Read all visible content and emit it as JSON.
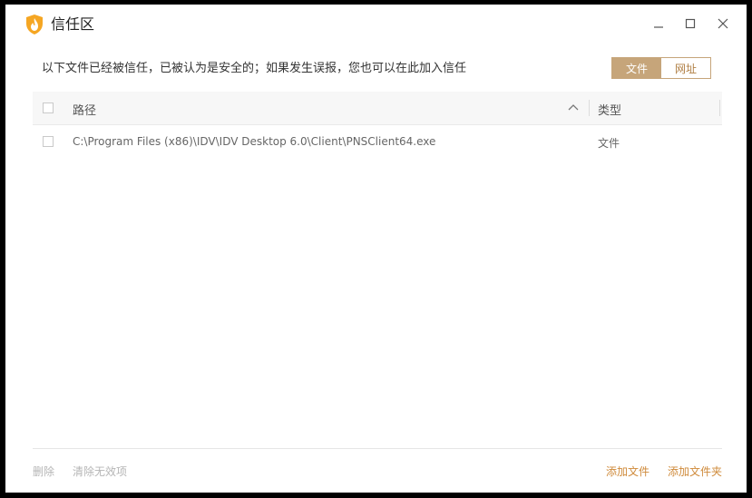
{
  "window": {
    "title": "信任区",
    "controls": {
      "minimize": "minimize",
      "maximize": "maximize",
      "close": "close"
    }
  },
  "description": "以下文件已经被信任，已被认为是安全的；如果发生误报，您也可以在此加入信任",
  "tabs": [
    {
      "label": "文件",
      "active": true
    },
    {
      "label": "网址",
      "active": false
    }
  ],
  "table": {
    "columns": {
      "path": "路径",
      "type": "类型"
    },
    "rows": [
      {
        "path": "C:\\Program Files (x86)\\IDV\\IDV Desktop 6.0\\Client\\PNSClient64.exe",
        "type": "文件"
      }
    ]
  },
  "footer": {
    "delete": "删除",
    "clear_invalid": "清除无效项",
    "add_file": "添加文件",
    "add_folder": "添加文件夹"
  },
  "colors": {
    "accent": "#c6a57a",
    "link": "#cf8a3a",
    "disabled": "#b5b5b5"
  }
}
